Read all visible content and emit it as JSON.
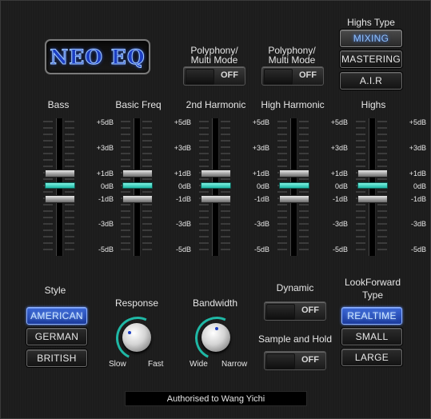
{
  "logo": {
    "text": "NEO EQ"
  },
  "polyphony1": {
    "label_line1": "Polyphony/",
    "label_line2": "Multi Mode",
    "state": "OFF"
  },
  "polyphony2": {
    "label_line1": "Polyphony/",
    "label_line2": "Multi Mode",
    "state": "OFF"
  },
  "highs_type": {
    "title": "Highs Type",
    "options": [
      "MIXING",
      "MASTERING",
      "A.I.R"
    ],
    "selected": "MIXING"
  },
  "bands": [
    {
      "label": "Bass",
      "gain_db": 1
    },
    {
      "label": "Basic Freq",
      "gain_db": 1
    },
    {
      "label": "2nd Harmonic",
      "gain_db": 1
    },
    {
      "label": "High Harmonic",
      "gain_db": 1
    },
    {
      "label": "Highs",
      "gain_db": 1
    }
  ],
  "scale_labels": [
    "+5dB",
    "+3dB",
    "+1dB",
    "0dB",
    "-1dB",
    "-3dB",
    "-5dB"
  ],
  "style": {
    "title": "Style",
    "options": [
      "AMERICAN",
      "GERMAN",
      "BRITISH"
    ],
    "selected": "AMERICAN"
  },
  "response": {
    "title": "Response",
    "min_label": "Slow",
    "max_label": "Fast"
  },
  "bandwidth": {
    "title": "Bandwidth",
    "min_label": "Wide",
    "max_label": "Narrow"
  },
  "dynamic": {
    "title": "Dynamic",
    "state": "OFF"
  },
  "sample_hold": {
    "title": "Sample and Hold",
    "state": "OFF"
  },
  "lookforward": {
    "title_line1": "LookForward",
    "title_line2": "Type",
    "options": [
      "REALTIME",
      "SMALL",
      "LARGE"
    ],
    "selected": "REALTIME"
  },
  "footer": {
    "text": "Authorised to Wang Yichi"
  },
  "colors": {
    "accent_blue": "#3c68d6",
    "accent_teal": "#1fb8a5",
    "logo_blue": "#1d3fc4"
  }
}
